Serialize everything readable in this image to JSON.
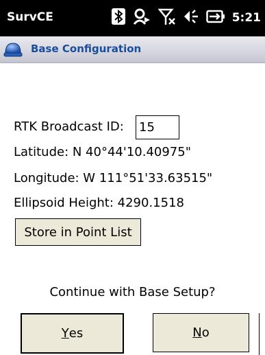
{
  "statusbar": {
    "app_name": "SurvCE",
    "time": "5:21",
    "icons": [
      "bluetooth-icon",
      "sync-icon",
      "no-signal-icon",
      "speaker-icon",
      "battery-icon"
    ]
  },
  "titlebar": {
    "title": "Base Configuration",
    "icon": "helmet-icon"
  },
  "fields": {
    "rtk_label": "RTK Broadcast ID:",
    "rtk_value": "15",
    "latitude": "Latitude:  N 40°44'10.40975\"",
    "longitude": "Longitude:  W 111°51'33.63515\"",
    "ellipsoid_height": "Ellipsoid Height: 4290.1518"
  },
  "buttons": {
    "store_label": "Store in Point List",
    "yes_accel": "Y",
    "yes_rest": "es",
    "no_accel": "N",
    "no_rest": "o"
  },
  "prompt": "Continue with Base Setup?",
  "colors": {
    "status_bg": "#000000",
    "title_text": "#1a4d9a",
    "button_face": "#ece9d8"
  }
}
